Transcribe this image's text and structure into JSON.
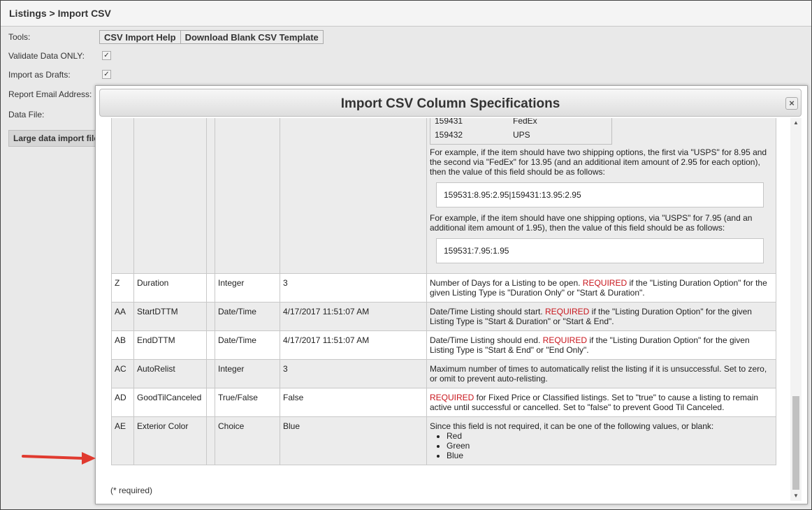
{
  "breadcrumb": "Listings > Import CSV",
  "form": {
    "tools_label": "Tools:",
    "csv_help_button": "CSV Import Help",
    "download_template_button": "Download Blank CSV Template",
    "validate_label": "Validate Data ONLY:",
    "drafts_label": "Import as Drafts:",
    "email_label": "Report Email Address:",
    "datafile_label": "Data File:",
    "large_import_label": "Large data import file",
    "checkmark": "✓"
  },
  "modal": {
    "title": "Import CSV Column Specifications",
    "close_label": "×",
    "shipping_rows": [
      {
        "code": "159431",
        "carrier": "FedEx"
      },
      {
        "code": "159432",
        "carrier": "UPS"
      }
    ],
    "example1": "For example, if the item should have two shipping options, the first via \"USPS\" for 8.95 and the second via \"FedEx\" for 13.95 (and an additional item amount of 2.95 for each option), then the value of this field should be as follows:",
    "example1_value": "159531:8.95:2.95|159431:13.95:2.95",
    "example2": "For example, if the item should have one shipping options, via \"USPS\" for 7.95 (and an additional item amount of 1.95), then the value of this field should be as follows:",
    "example2_value": "159531:7.95:1.95",
    "rows": [
      {
        "col": "Z",
        "name": "Duration",
        "type": "Integer",
        "example": "3",
        "d1": "Number of Days for a Listing to be open. ",
        "req": "REQUIRED",
        "d2": " if the \"Listing Duration Option\" for the given Listing Type is \"Duration Only\" or \"Start & Duration\"."
      },
      {
        "col": "AA",
        "name": "StartDTTM",
        "type": "Date/Time",
        "example": "4/17/2017 11:51:07 AM",
        "d1": "Date/Time Listing should start. ",
        "req": "REQUIRED",
        "d2": " if the \"Listing Duration Option\" for the given Listing Type is \"Start & Duration\" or \"Start & End\"."
      },
      {
        "col": "AB",
        "name": "EndDTTM",
        "type": "Date/Time",
        "example": "4/17/2017 11:51:07 AM",
        "d1": "Date/Time Listing should end. ",
        "req": "REQUIRED",
        "d2": " if the \"Listing Duration Option\" for the given Listing Type is \"Start & End\" or \"End Only\"."
      },
      {
        "col": "AC",
        "name": "AutoRelist",
        "type": "Integer",
        "example": "3",
        "d1": "Maximum number of times to automatically relist the listing if it is unsuccessful. Set to zero, or omit to prevent auto-relisting.",
        "req": "",
        "d2": ""
      },
      {
        "col": "AD",
        "name": "GoodTilCanceled",
        "type": "True/False",
        "example": "False",
        "d1": "",
        "req": "REQUIRED",
        "d2": " for Fixed Price or Classified listings. Set to \"true\" to cause a listing to remain active until successful or cancelled. Set to \"false\" to prevent Good Til Canceled."
      }
    ],
    "last_row": {
      "col": "AE",
      "name": "Exterior Color",
      "type": "Choice",
      "example": "Blue",
      "intro": "Since this field is not required, it can be one of the following values, or blank:",
      "options": [
        "Red",
        "Green",
        "Blue"
      ]
    },
    "footnote": "(* required)"
  },
  "colors": {
    "required": "#c8161d",
    "arrow": "#e03a2f"
  }
}
